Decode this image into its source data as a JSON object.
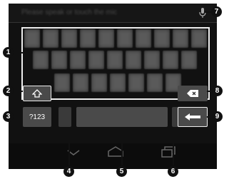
{
  "keyboard": {
    "hint_text": "Please speak or touch the mic"
  },
  "keys": {
    "shift_icon": "shift-arrow-icon",
    "symbols_label": "?123",
    "delete_icon": "backspace-icon",
    "enter_icon": "enter-arrow-icon",
    "mic_icon": "microphone-icon"
  },
  "navigation": {
    "back_icon": "back-chevron-icon",
    "home_icon": "home-icon",
    "recent_icon": "recent-apps-icon"
  },
  "callouts": [
    "1",
    "2",
    "3",
    "4",
    "5",
    "6",
    "7",
    "8",
    "9"
  ]
}
